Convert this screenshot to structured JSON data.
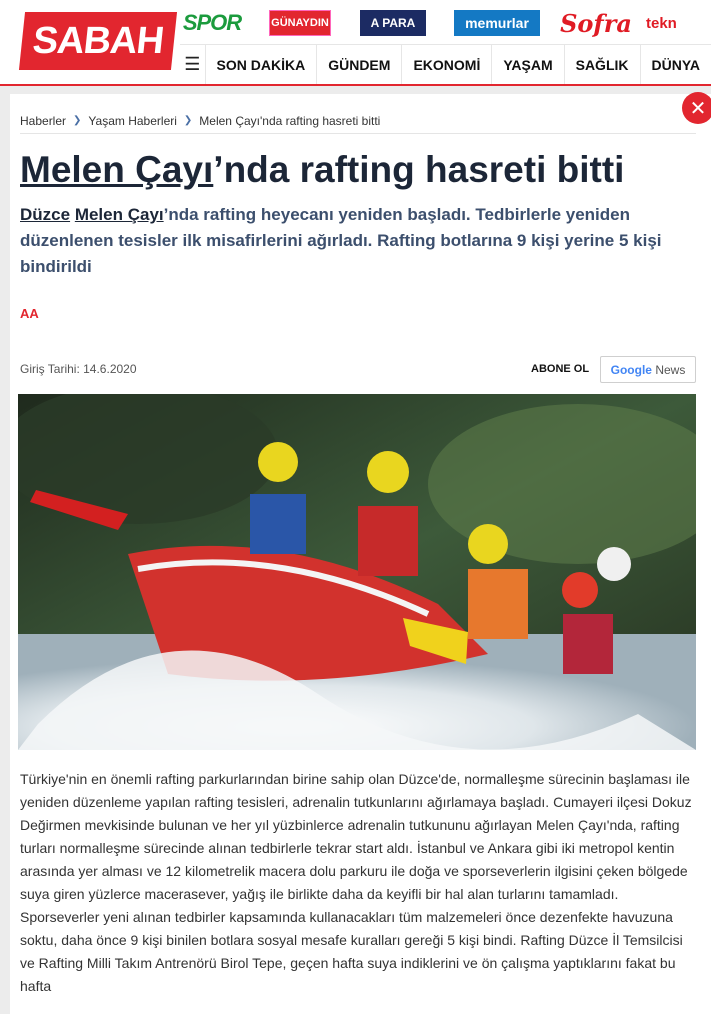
{
  "header": {
    "logo": "SABAH",
    "brands": [
      {
        "label": "SPOR",
        "name": "spor"
      },
      {
        "label": "GÜNAYDIN",
        "name": "gunaydin"
      },
      {
        "label": "A PARA",
        "name": "apara"
      },
      {
        "label": "memurlar",
        "name": "memurlar"
      },
      {
        "label": "Sofra",
        "name": "sofra"
      },
      {
        "label": "tekn",
        "name": "tekno"
      }
    ],
    "nav": [
      "SON DAKİKA",
      "GÜNDEM",
      "EKONOMİ",
      "YAŞAM",
      "SAĞLIK",
      "DÜNYA"
    ]
  },
  "breadcrumb": [
    "Haberler",
    "Yaşam Haberleri",
    "Melen Çayı'nda rafting hasreti bitti"
  ],
  "article": {
    "title_link": "Melen Çayı",
    "title_rest": "’nda rafting hasreti bitti",
    "spot_link1": "Düzce",
    "spot_link2": "Melen Çayı",
    "spot_rest": "’nda rafting heyecanı yeniden başladı. Tedbirlerle yeniden düzenlenen tesisler ilk misafirlerini ağırladı. Rafting botlarına 9 kişi yerine 5 kişi bindirildi",
    "source": "AA",
    "date": "Giriş Tarihi: 14.6.2020",
    "subscribe": "ABONE OL",
    "gnews_g": "Google",
    "gnews_rest": "News",
    "body": "Türkiye'nin en önemli rafting parkurlarından birine sahip olan Düzce'de, normalleşme sürecinin başlaması ile yeniden düzenleme yapılan rafting tesisleri, adrenalin tutkunlarını ağırlamaya başladı. Cumayeri ilçesi Dokuz Değirmen mevkisinde bulunan ve her yıl yüzbinlerce adrenalin tutkununu ağırlayan Melen Çayı'nda, rafting turları normalleşme sürecinde alınan tedbirlerle tekrar start aldı. İstanbul ve Ankara gibi iki metropol kentin arasında yer alması ve 12 kilometrelik macera dolu parkuru ile doğa ve sporseverlerin ilgisini çeken bölgede suya giren yüzlerce macerasever, yağış ile birlikte daha da keyifli bir hal alan turlarını tamamladı. Sporseverler yeni alınan tedbirler kapsamında kullanacakları tüm malzemeleri önce dezenfekte havuzuna soktu, daha önce 9 kişi binilen botlara sosyal mesafe kuralları gereği 5 kişi bindi. Rafting Düzce İl Temsilcisi ve Rafting Milli Takım Antrenörü Birol Tepe, geçen hafta suya indiklerini ve ön çalışma yaptıklarını fakat bu hafta"
  },
  "icons": {
    "close": "close-icon",
    "menu": "hamburger-icon",
    "breadcrumb_sep": "chevron-right-icon"
  },
  "colors": {
    "brand_red": "#e2262f",
    "title": "#1c2637",
    "spot": "#3c4f6d"
  }
}
